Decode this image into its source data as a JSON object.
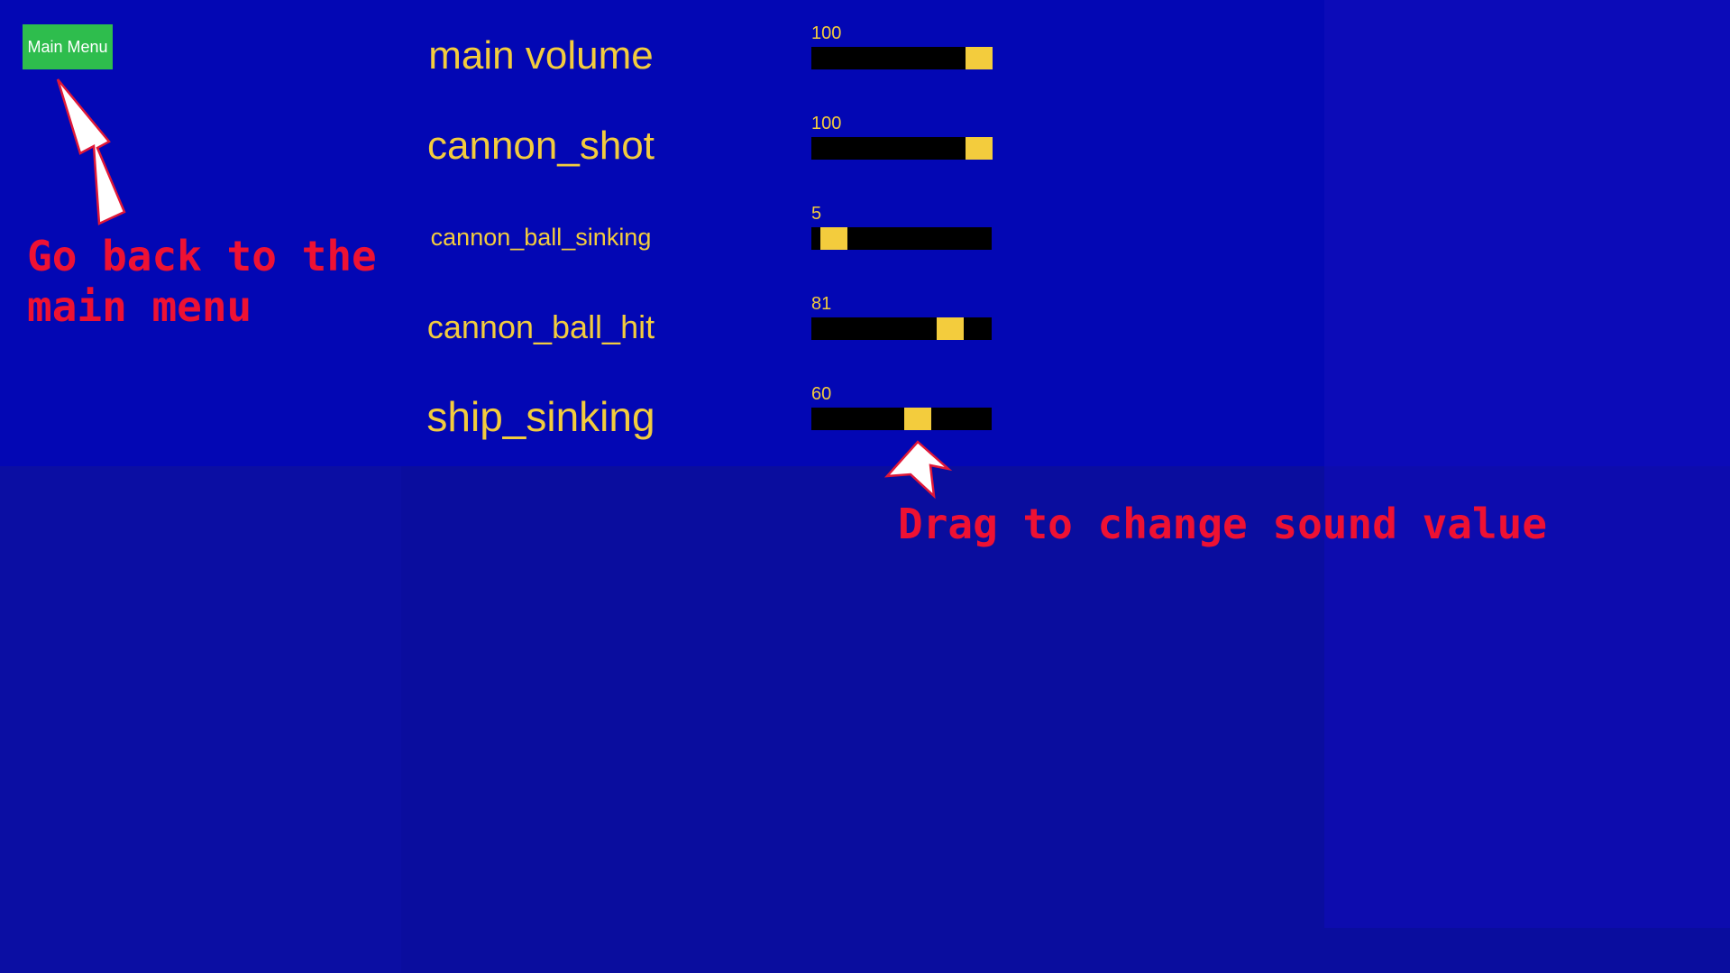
{
  "menu_button": {
    "label": "Main Menu"
  },
  "hints": {
    "back": "Go back to the main menu",
    "drag": "Drag to change sound value"
  },
  "sliders": [
    {
      "name": "main volume",
      "value": "100",
      "level": 100
    },
    {
      "name": "cannon_shot",
      "value": "100",
      "level": 100
    },
    {
      "name": "cannon_ball_sinking",
      "value": "5",
      "level": 5
    },
    {
      "name": "cannon_ball_hit",
      "value": "81",
      "level": 81
    },
    {
      "name": "ship_sinking",
      "value": "60",
      "level": 60
    }
  ],
  "colors": {
    "accent_text": "#f3cc3d",
    "hint_text": "#ee1133",
    "button_bg": "#2ebd4d",
    "track": "#000000",
    "background": "#0307b4"
  },
  "icons": {
    "pointer_arrows": "arrow-pointer-icon"
  }
}
